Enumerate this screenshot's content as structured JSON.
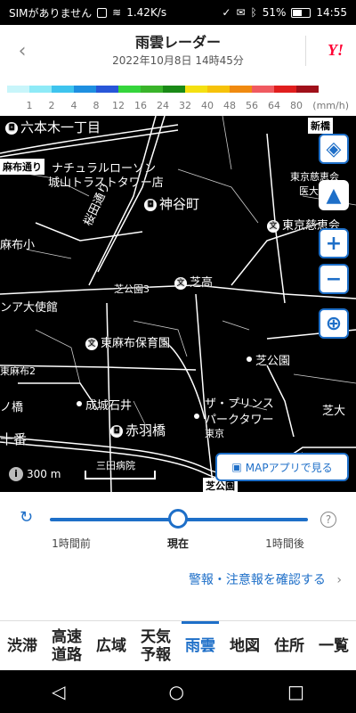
{
  "status_bar": {
    "carrier": "SIMがありません",
    "speed": "1.42K/s",
    "battery": "51%",
    "time": "14:55"
  },
  "header": {
    "title": "雨雲レーダー",
    "subtitle": "2022年10月8日 14時45分",
    "logo": "Y!"
  },
  "legend": {
    "colors": [
      "#c8f5fa",
      "#8eeaf7",
      "#3ec4ee",
      "#1e8fe0",
      "#2856d8",
      "#35d53c",
      "#39b42a",
      "#1a8a17",
      "#f4e012",
      "#f6c20a",
      "#f08a10",
      "#f05a60",
      "#e01e1e",
      "#a0101a"
    ],
    "labels": [
      "1",
      "2",
      "4",
      "8",
      "12",
      "16",
      "24",
      "32",
      "40",
      "48",
      "56",
      "64",
      "80"
    ],
    "unit": "(mm/h)"
  },
  "map": {
    "labels": {
      "roppongi": "六本木一丁目",
      "azabudori": "麻布通り",
      "natural_lawson": "ナチュラルローソン",
      "shiroyama": "城山トラストタワー店",
      "kamiyacho": "神谷町",
      "jikei": "東京慈恵会",
      "jikei_med": "東京慈恵会",
      "ika": "医大",
      "azabu_sho": "麻布小",
      "sakura": "桜田通り",
      "shibakoen3": "芝公園3",
      "shiba_high": "芝高",
      "embassy": "ンア大使館",
      "higashiazabu": "東麻布保育園",
      "shibakoen": "芝公園",
      "higashiazabu2": "東麻布2",
      "bashi": "ノ橋",
      "seijo": "成城石井",
      "prince_1": "ザ・プリンス",
      "prince_2": "パークタワー",
      "tokyo": "東京",
      "jusban": "十番",
      "akabanebashi": "赤羽橋",
      "mita": "三田病院",
      "shibadai": "芝大",
      "shinbashi": "新橋",
      "shibakoen_small": "芝公園",
      "scale": "300 m"
    },
    "map_app_button": "MAPアプリで見る"
  },
  "timeline": {
    "before": "1時間前",
    "now": "現在",
    "after": "1時間後",
    "alert_link": "警報・注意報を確認する"
  },
  "bottom_nav": [
    {
      "label": "渋滞"
    },
    {
      "label": "高速\n道路"
    },
    {
      "label": "広域"
    },
    {
      "label": "天気\n予報"
    },
    {
      "label": "雨雲"
    },
    {
      "label": "地図"
    },
    {
      "label": "住所"
    },
    {
      "label": "一覧"
    }
  ]
}
